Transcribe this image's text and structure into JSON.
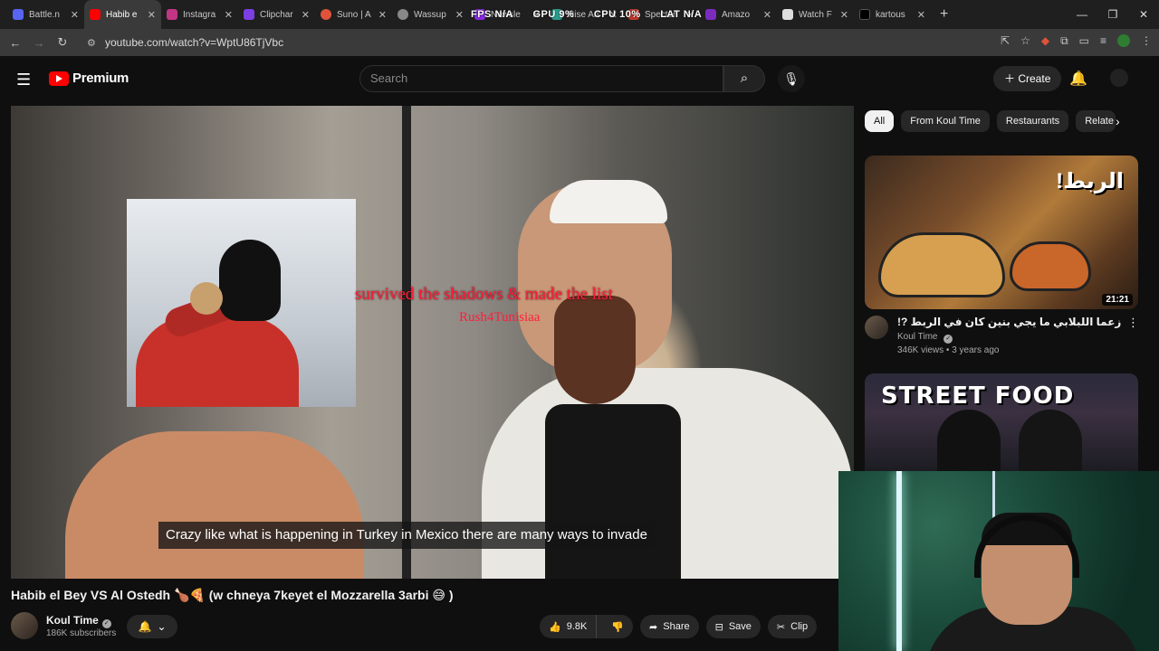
{
  "browser": {
    "tabs": [
      {
        "label": "Battle.n",
        "color": "#5865f2"
      },
      {
        "label": "Habib e",
        "color": "#ff0000"
      },
      {
        "label": "Instagra",
        "color": "#c13584"
      },
      {
        "label": "Clipchar",
        "color": "#7b3fe4"
      },
      {
        "label": "Suno | A",
        "color": "#e0533a"
      },
      {
        "label": "Wassup",
        "color": "#888888"
      },
      {
        "label": "Newsle",
        "color": "#8a2be2"
      },
      {
        "label": "Rise An",
        "color": "#2a9d8f"
      },
      {
        "label": "Specter",
        "color": "#c0392b"
      },
      {
        "label": "Amazo",
        "color": "#7b2cbf"
      },
      {
        "label": "Watch F",
        "color": "#dddddd"
      },
      {
        "label": "kartous",
        "color": "#000000"
      }
    ],
    "new_tab": "+",
    "url": "youtube.com/watch?v=WptU86TjVbc",
    "overlay_stats": [
      "FPS N/A",
      "GPU 9%",
      "CPU 10%",
      "LAT N/A"
    ]
  },
  "youtube": {
    "logo_text": "Premium",
    "search_placeholder": "Search",
    "create_label": "Create",
    "video": {
      "overlay_text": "survived the shadows & made the list",
      "overlay_sub": "Rush4Tunisiaa",
      "caption": "Crazy like what is happening in Turkey in Mexico there are many ways to invade"
    },
    "title": "Habib el Bey VS Al Ostedh 🍗🍕 (w chneya 7keyet el Mozzarella 3arbi 😅 )",
    "channel": {
      "name": "Koul Time",
      "subscribers": "186K subscribers"
    },
    "actions": {
      "likes": "9.8K",
      "share": "Share",
      "save": "Save",
      "clip": "Clip"
    },
    "chips": [
      "All",
      "From Koul Time",
      "Restaurants",
      "Relate"
    ],
    "recommendations": [
      {
        "thumb_text": "!الربط",
        "duration": "21:21",
        "title": "زعما اللبلابي ما يجي بنين كان في الربط ?!",
        "channel": "Koul Time",
        "views": "346K views",
        "age": "3 years ago"
      },
      {
        "thumb_text": "STREET FOOD"
      }
    ]
  }
}
